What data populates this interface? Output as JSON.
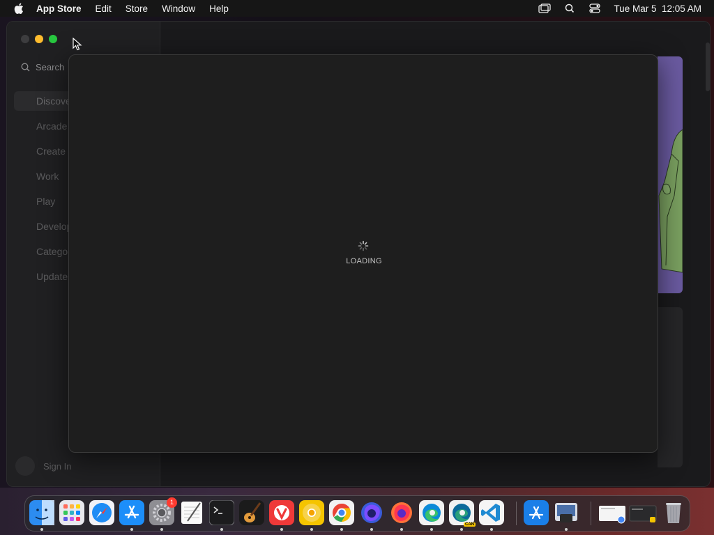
{
  "menubar": {
    "apple_icon": "apple-logo-icon",
    "app_name": "App Store",
    "menus": [
      "Edit",
      "Store",
      "Window",
      "Help"
    ],
    "datetime": "Tue Mar 5  12:05 AM",
    "status_icons": [
      "screen-mirroring-icon",
      "spotlight-search-icon",
      "control-center-icon"
    ]
  },
  "sidebar": {
    "search_placeholder": "Search",
    "items": [
      {
        "label": "Discover",
        "active": true
      },
      {
        "label": "Arcade"
      },
      {
        "label": "Create"
      },
      {
        "label": "Work"
      },
      {
        "label": "Play"
      },
      {
        "label": "Develop"
      },
      {
        "label": "Categories"
      },
      {
        "label": "Updates"
      }
    ],
    "signin_label": "Sign In"
  },
  "loading": {
    "label": "LOADING"
  },
  "dock": {
    "apps": [
      {
        "name": "Finder",
        "icon": "finder-icon",
        "running": true
      },
      {
        "name": "Launchpad",
        "icon": "launchpad-icon",
        "running": false
      },
      {
        "name": "Safari",
        "icon": "safari-icon",
        "running": false
      },
      {
        "name": "App Store",
        "icon": "app-store-icon",
        "running": true
      },
      {
        "name": "System Settings",
        "icon": "system-settings-icon",
        "running": true,
        "badge": "1"
      },
      {
        "name": "TextEdit",
        "icon": "textedit-icon",
        "running": false
      },
      {
        "name": "Terminal",
        "icon": "terminal-icon",
        "running": true
      },
      {
        "name": "GarageBand",
        "icon": "garageband-icon",
        "running": false
      },
      {
        "name": "Vivaldi",
        "icon": "vivaldi-icon",
        "running": true
      },
      {
        "name": "Chrome Canary",
        "icon": "chrome-canary-icon",
        "running": true
      },
      {
        "name": "Google Chrome",
        "icon": "chrome-icon",
        "running": true
      },
      {
        "name": "Firefox Developer Edition",
        "icon": "firefox-dev-icon",
        "running": true
      },
      {
        "name": "Firefox",
        "icon": "firefox-icon",
        "running": true
      },
      {
        "name": "Microsoft Edge",
        "icon": "edge-icon",
        "running": true
      },
      {
        "name": "Microsoft Edge Canary",
        "icon": "edge-canary-icon",
        "running": true,
        "tag": "CAN"
      },
      {
        "name": "Visual Studio Code",
        "icon": "vscode-icon",
        "running": true
      },
      {
        "name": "Xcode Simulator",
        "icon": "simulator-icon",
        "running": false
      },
      {
        "name": "Preview",
        "icon": "preview-icon",
        "running": true
      },
      {
        "name": "Recent Document",
        "icon": "document-thumbnail-icon",
        "running": false
      },
      {
        "name": "Recent Window",
        "icon": "window-thumbnail-icon",
        "running": false
      },
      {
        "name": "Trash",
        "icon": "trash-icon",
        "running": false
      }
    ]
  }
}
